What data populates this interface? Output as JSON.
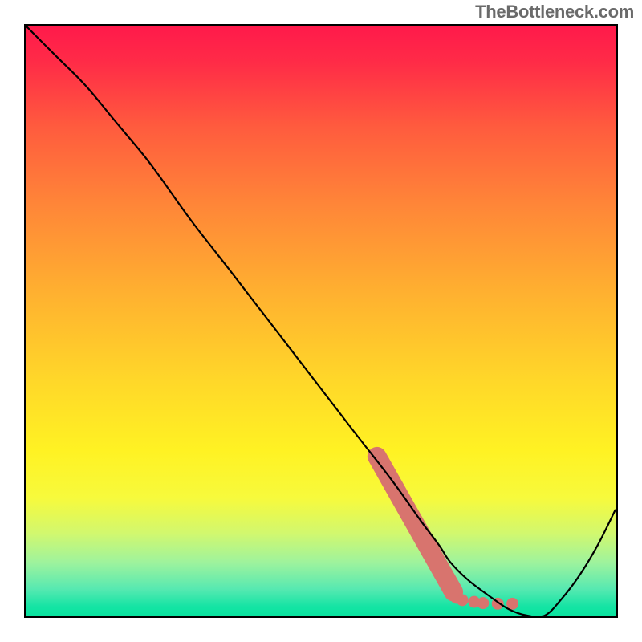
{
  "watermark": "TheBottleneck.com",
  "chart_data": {
    "type": "line",
    "title": "",
    "xlabel": "",
    "ylabel": "",
    "xlim": [
      0,
      100
    ],
    "ylim": [
      0,
      100
    ],
    "grid": false,
    "legend": false,
    "background": {
      "type": "vertical-gradient",
      "stops": [
        {
          "pos": 0.0,
          "color": "#ff1a4b"
        },
        {
          "pos": 0.06,
          "color": "#ff2b47"
        },
        {
          "pos": 0.17,
          "color": "#ff5b3e"
        },
        {
          "pos": 0.3,
          "color": "#ff8538"
        },
        {
          "pos": 0.45,
          "color": "#ffb030"
        },
        {
          "pos": 0.6,
          "color": "#ffd729"
        },
        {
          "pos": 0.72,
          "color": "#fff223"
        },
        {
          "pos": 0.8,
          "color": "#f7fa3c"
        },
        {
          "pos": 0.86,
          "color": "#d2f86e"
        },
        {
          "pos": 0.91,
          "color": "#9ef39d"
        },
        {
          "pos": 0.955,
          "color": "#57e9b1"
        },
        {
          "pos": 0.985,
          "color": "#14e4a4"
        },
        {
          "pos": 1.0,
          "color": "#0be39f"
        }
      ]
    },
    "series": [
      {
        "name": "bottleneck-curve",
        "x": [
          0,
          5,
          10,
          15,
          20,
          23,
          28,
          35,
          45,
          55,
          62,
          67,
          70,
          72,
          75,
          79,
          82,
          85,
          88,
          91,
          94,
          97,
          100
        ],
        "y": [
          100,
          95,
          90,
          84,
          78,
          74,
          67,
          58,
          45,
          32,
          23,
          16,
          12,
          9,
          6,
          3,
          1,
          0,
          0,
          3,
          7,
          12,
          18
        ]
      }
    ],
    "highlight_diagonal": {
      "name": "highlight-segment",
      "x": [
        59.5,
        72.5
      ],
      "y": [
        27,
        4
      ],
      "color": "#d8746e"
    },
    "highlight_dots": {
      "name": "highlight-dots",
      "color": "#d8746e",
      "points": [
        {
          "x": 73,
          "y": 3.0
        },
        {
          "x": 74,
          "y": 2.6
        },
        {
          "x": 76,
          "y": 2.3
        },
        {
          "x": 77.5,
          "y": 2.1
        },
        {
          "x": 80,
          "y": 2.0
        },
        {
          "x": 82.5,
          "y": 2.0
        }
      ]
    }
  }
}
